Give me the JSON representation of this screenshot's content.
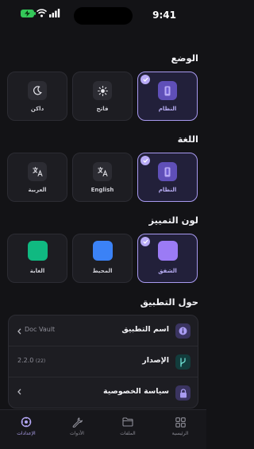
{
  "status_bar": {
    "time": "9:41"
  },
  "sections": {
    "mode": "الوضع",
    "language": "اللغة",
    "accent": "لون التمييز",
    "about": "حول التطبيق"
  },
  "mode_options": [
    {
      "label": "النظام",
      "icon": "phone-icon",
      "selected": true
    },
    {
      "label": "فاتح",
      "icon": "sun-icon",
      "selected": false
    },
    {
      "label": "داكن",
      "icon": "moon-icon",
      "selected": false
    }
  ],
  "language_options": [
    {
      "label": "النظام",
      "icon": "phone-icon",
      "selected": true
    },
    {
      "label": "English",
      "icon": "translate-icon",
      "selected": false
    },
    {
      "label": "العربية",
      "icon": "translate-icon",
      "selected": false
    }
  ],
  "accent_options": [
    {
      "label": "الشفق",
      "color": "#9b7bf5",
      "selected": true
    },
    {
      "label": "المحيط",
      "color": "#3b82f6",
      "selected": false
    },
    {
      "label": "الغابة",
      "color": "#10b981",
      "selected": false
    }
  ],
  "about": {
    "app_name_label": "اسم التطبيق",
    "app_name_value": "Doc Vault",
    "version_label": "الإصدار",
    "version_value": "2.2.0",
    "build_value": "(22)",
    "privacy_label": "سياسة الخصوصية"
  },
  "tabs": [
    {
      "label": "الرئيسية",
      "icon": "grid-icon",
      "active": false
    },
    {
      "label": "الملفات",
      "icon": "folder-icon",
      "active": false
    },
    {
      "label": "الأدوات",
      "icon": "wrench-icon",
      "active": false
    },
    {
      "label": "الإعدادات",
      "icon": "settings-icon",
      "active": true
    }
  ],
  "colors": {
    "accent": "#a89af0",
    "background": "#131316",
    "card": "#1d1d22"
  }
}
